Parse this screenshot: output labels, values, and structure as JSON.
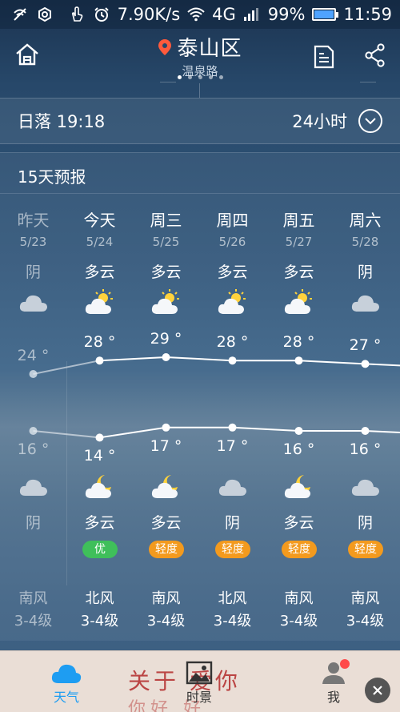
{
  "status_bar": {
    "speed": "7.90K/s",
    "network": "4G",
    "battery": "99%",
    "battery_level": 0.99,
    "time": "11:59"
  },
  "header": {
    "city": "泰山区",
    "district": "温泉路",
    "page_count": 5,
    "active_page": 0
  },
  "sunset": {
    "label": "日落 19:18",
    "hours_label": "24小时"
  },
  "forecast": {
    "title": "15天预报",
    "days": [
      {
        "name": "昨天",
        "date": "5/23",
        "day_cond": "阴",
        "day_icon": "cloud-icon",
        "high": "24 °",
        "high_val": 24,
        "low": "16 °",
        "low_val": 16,
        "night_icon": "cloud-icon",
        "night_cond": "阴",
        "aqi": "",
        "wind_dir": "南风",
        "wind_lvl": "3-4级",
        "past": true
      },
      {
        "name": "今天",
        "date": "5/24",
        "day_cond": "多云",
        "day_icon": "partly-cloudy-sun-icon",
        "high": "28 °",
        "high_val": 28,
        "low": "14 °",
        "low_val": 14,
        "night_icon": "partly-cloudy-moon-icon",
        "night_cond": "多云",
        "aqi": "优",
        "aqi_color": "#3fbf5a",
        "wind_dir": "北风",
        "wind_lvl": "3-4级",
        "past": false
      },
      {
        "name": "周三",
        "date": "5/25",
        "day_cond": "多云",
        "day_icon": "partly-cloudy-sun-icon",
        "high": "29 °",
        "high_val": 29,
        "low": "17 °",
        "low_val": 17,
        "night_icon": "partly-cloudy-moon-icon",
        "night_cond": "多云",
        "aqi": "轻度",
        "aqi_color": "#f39a1e",
        "wind_dir": "南风",
        "wind_lvl": "3-4级",
        "past": false
      },
      {
        "name": "周四",
        "date": "5/26",
        "day_cond": "多云",
        "day_icon": "partly-cloudy-sun-icon",
        "high": "28 °",
        "high_val": 28,
        "low": "17 °",
        "low_val": 17,
        "night_icon": "cloud-icon",
        "night_cond": "阴",
        "aqi": "轻度",
        "aqi_color": "#f39a1e",
        "wind_dir": "北风",
        "wind_lvl": "3-4级",
        "past": false
      },
      {
        "name": "周五",
        "date": "5/27",
        "day_cond": "多云",
        "day_icon": "partly-cloudy-sun-icon",
        "high": "28 °",
        "high_val": 28,
        "low": "16 °",
        "low_val": 16,
        "night_icon": "partly-cloudy-moon-icon",
        "night_cond": "多云",
        "aqi": "轻度",
        "aqi_color": "#f39a1e",
        "wind_dir": "南风",
        "wind_lvl": "3-4级",
        "past": false
      },
      {
        "name": "周六",
        "date": "5/28",
        "day_cond": "阴",
        "day_icon": "cloud-icon",
        "high": "27 °",
        "high_val": 27,
        "low": "16 °",
        "low_val": 16,
        "night_icon": "cloud-icon",
        "night_cond": "阴",
        "aqi": "轻度",
        "aqi_color": "#f39a1e",
        "wind_dir": "南风",
        "wind_lvl": "3-4级",
        "past": false
      }
    ]
  },
  "ad": {
    "text": "关于 爱你",
    "text2": "你好 好"
  },
  "bottom_nav": {
    "weather": "天气",
    "time_view": "时景",
    "me": "我"
  },
  "colors": {
    "accent": "#1e9df2",
    "aqi_light": "#f39a1e",
    "aqi_good": "#3fbf5a",
    "pin": "#ff5a3c"
  }
}
